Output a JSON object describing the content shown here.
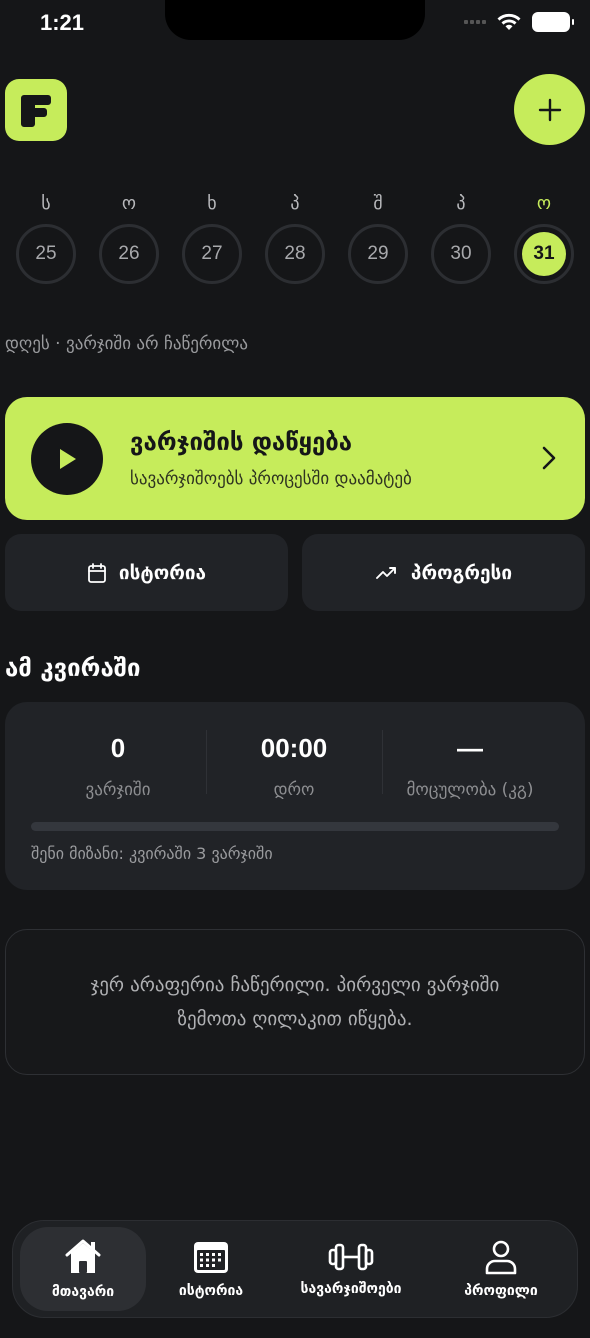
{
  "status_bar": {
    "time": "1:21"
  },
  "header": {
    "logo_icon": "f-logo-icon",
    "add_icon": "plus-icon",
    "accent": "#c6ec5b"
  },
  "week": {
    "days": [
      {
        "letter": "ს",
        "date": "25"
      },
      {
        "letter": "ო",
        "date": "26"
      },
      {
        "letter": "ხ",
        "date": "27"
      },
      {
        "letter": "პ",
        "date": "28"
      },
      {
        "letter": "შ",
        "date": "29"
      },
      {
        "letter": "პ",
        "date": "30"
      },
      {
        "letter": "ო",
        "date": "31"
      }
    ],
    "selected_date": "31"
  },
  "today_status": "დღეს · ვარჯიში არ ჩაწერილა",
  "start_card": {
    "title": "ვარჯიშის დაწყება",
    "subtitle": "სავარჯიშოებს პროცესში დაამატებ"
  },
  "quick_actions": {
    "history_label": "ისტორია",
    "progress_label": "პროგრესი"
  },
  "this_week": {
    "title": "ამ კვირაში",
    "stats": [
      {
        "value": "0",
        "label": "ვარჯიში"
      },
      {
        "value": "00:00",
        "label": "დრო"
      },
      {
        "value": "—",
        "label": "მოცულობა (კგ)"
      }
    ],
    "goal_progress": 0,
    "goal_text": "შენი მიზანი: კვირაში 3 ვარჯიში"
  },
  "empty_state": "ჯერ არაფერია ჩაწერილი. პირველი ვარჯიში ზემოთა ღილაკით იწყება.",
  "tab_bar": {
    "tabs": [
      {
        "label": "მთავარი",
        "icon": "home-icon"
      },
      {
        "label": "ისტორია",
        "icon": "calendar-icon"
      },
      {
        "label": "სავარჯიშოები",
        "icon": "dumbbell-icon"
      },
      {
        "label": "პროფილი",
        "icon": "profile-icon"
      }
    ],
    "active_index": 0
  }
}
